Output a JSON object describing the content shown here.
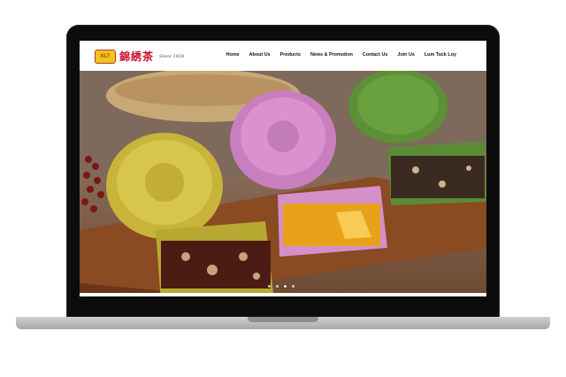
{
  "brand": {
    "badge": "KLT",
    "chinese_name": "錦綉茶",
    "since": "Since 1928"
  },
  "nav": {
    "items": [
      {
        "label": "Home"
      },
      {
        "label": "About Us"
      },
      {
        "label": "Products"
      },
      {
        "label": "News & Promotion"
      },
      {
        "label": "Contact Us"
      },
      {
        "label": "Join Us"
      },
      {
        "label": "Lum Tuck Loy"
      }
    ]
  },
  "carousel": {
    "slide_count": 4,
    "active_index": 2
  },
  "colors": {
    "brand_red": "#c8102e",
    "brand_gold": "#f0c419"
  }
}
